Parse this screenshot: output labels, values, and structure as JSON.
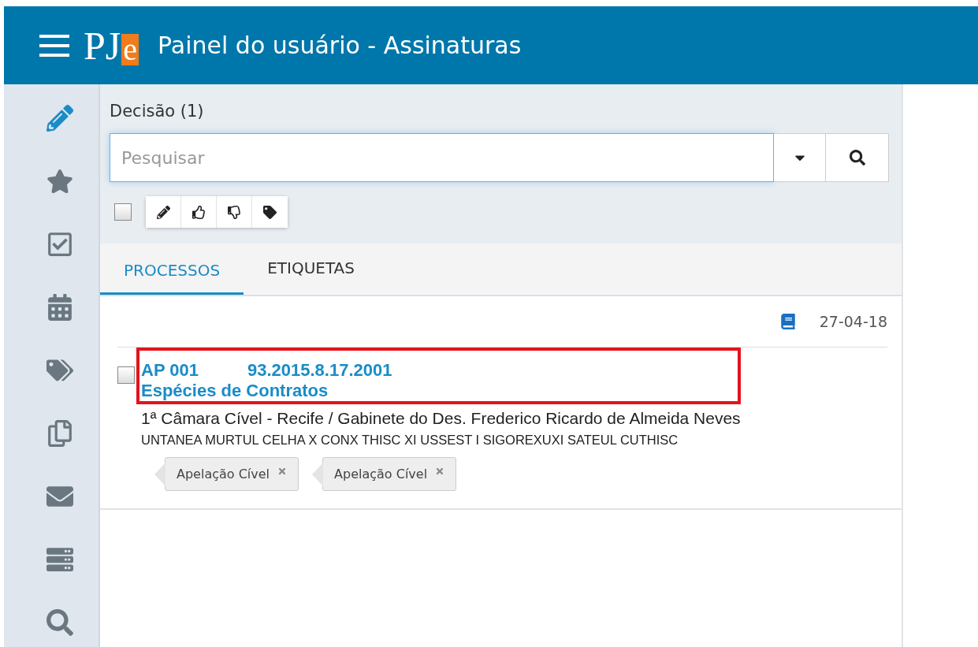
{
  "header": {
    "logo": "PJ",
    "logo_accent": "e",
    "title": "Painel do usuário - Assinaturas"
  },
  "sidebar": {
    "items": [
      {
        "kind": "pencil",
        "selected": true
      },
      {
        "kind": "star",
        "selected": false
      },
      {
        "kind": "check",
        "selected": false
      },
      {
        "kind": "calendar",
        "selected": false
      },
      {
        "kind": "tags",
        "selected": false
      },
      {
        "kind": "copy",
        "selected": false
      },
      {
        "kind": "mail",
        "selected": false
      },
      {
        "kind": "server",
        "selected": false
      },
      {
        "kind": "search",
        "selected": false
      }
    ]
  },
  "panel": {
    "heading": "Decisão (1)",
    "search": {
      "placeholder": "Pesquisar"
    },
    "select_all": {
      "checked": false
    },
    "actions": [
      {
        "kind": "pencil"
      },
      {
        "kind": "thumbs-up"
      },
      {
        "kind": "thumbs-down"
      },
      {
        "kind": "tag"
      }
    ],
    "tabs": [
      {
        "label": "PROCESSOS",
        "selected": true
      },
      {
        "label": "ETIQUETAS",
        "selected": false
      }
    ],
    "list": {
      "date": "27-04-18",
      "items": [
        {
          "checked": false,
          "highlighted": true,
          "class_code": "AP 001",
          "number": "93.2015.8.17.2001",
          "subject": "Espécies de Contratos",
          "court": "1ª Câmara Cível - Recife / Gabinete do Des. Frederico Ricardo de Almeida Neves",
          "parties": "UNTANEA MURTUL CELHA X CONX THISC XI USSEST I SIGOREXUXI SATEUL CUTHISC",
          "tags": [
            "Apelação Cível",
            "Apelação Cível"
          ]
        }
      ]
    }
  }
}
